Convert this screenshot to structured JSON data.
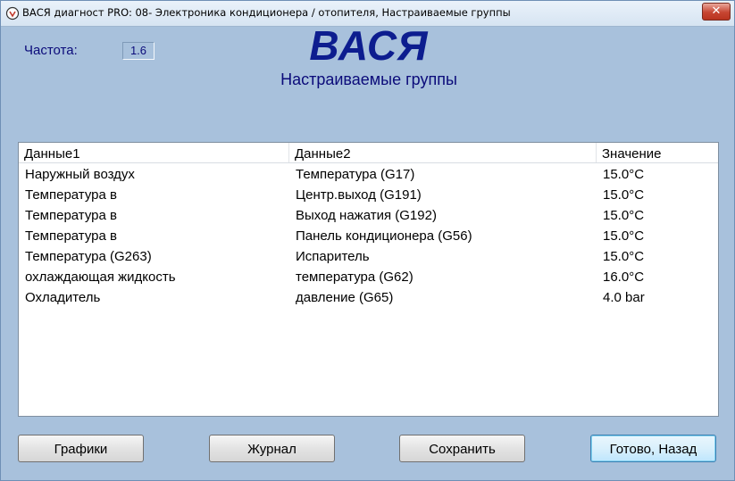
{
  "window": {
    "title": "ВАСЯ диагност PRO: 08- Электроника кондиционера / отопителя,  Настраиваемые группы",
    "close_label": "✕"
  },
  "header": {
    "frequency_label": "Частота:",
    "frequency_value": "1.6",
    "logo": "ВАСЯ",
    "subtitle": "Настраиваемые группы"
  },
  "table": {
    "columns": [
      "Данные1",
      "Данные2",
      "Значение"
    ],
    "rows": [
      {
        "data1": "Наружный воздух",
        "data2": "Температура (G17)",
        "value": "15.0°C"
      },
      {
        "data1": "Температура в",
        "data2": "Центр.выход (G191)",
        "value": "15.0°C"
      },
      {
        "data1": "Температура в",
        "data2": "Выход нажатия (G192)",
        "value": "15.0°C"
      },
      {
        "data1": "Температура в",
        "data2": "Панель кондиционера (G56)",
        "value": "15.0°C"
      },
      {
        "data1": "Температура (G263)",
        "data2": "Испаритель",
        "value": "15.0°C"
      },
      {
        "data1": "охлаждающая жидкость",
        "data2": "температура (G62)",
        "value": "16.0°C"
      },
      {
        "data1": "Охладитель",
        "data2": "давление (G65)",
        "value": "4.0 bar"
      }
    ]
  },
  "buttons": {
    "graphs": "Графики",
    "journal": "Журнал",
    "save": "Сохранить",
    "done_back": "Готово, Назад"
  },
  "colors": {
    "background": "#a8c1dc",
    "accent_text": "#0b0b7a",
    "logo": "#0d1d8f"
  },
  "icons": {
    "app": "app-logo-icon",
    "close": "close-icon"
  }
}
